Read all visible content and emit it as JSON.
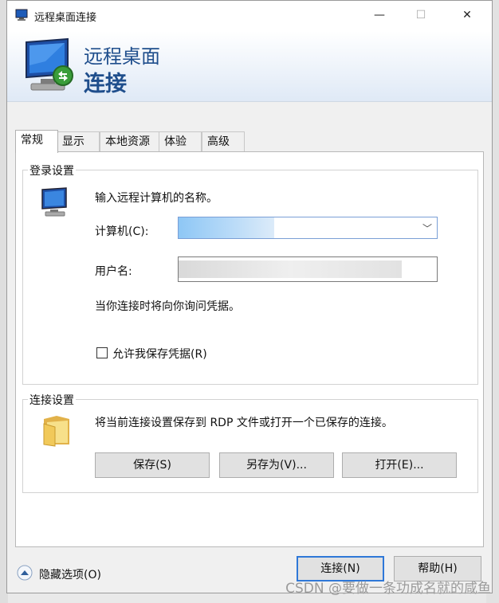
{
  "window": {
    "title": "远程桌面连接",
    "minimize_glyph": "—",
    "maximize_glyph": "☐",
    "close_glyph": "✕"
  },
  "banner": {
    "line1": "远程桌面",
    "line2": "连接",
    "icon": "monitor-remote-icon"
  },
  "tabs": [
    {
      "label": "常规",
      "active": true
    },
    {
      "label": "显示",
      "active": false
    },
    {
      "label": "本地资源",
      "active": false
    },
    {
      "label": "体验",
      "active": false
    },
    {
      "label": "高级",
      "active": false
    }
  ],
  "login_settings": {
    "legend": "登录设置",
    "instruction": "输入远程计算机的名称。",
    "computer_label": "计算机(C):",
    "username_label": "用户名:",
    "note": "当你连接时将向你询问凭据。",
    "allow_save_label": "允许我保存凭据(R)",
    "allow_save_checked": false
  },
  "connection_settings": {
    "legend": "连接设置",
    "description": "将当前连接设置保存到 RDP 文件或打开一个已保存的连接。",
    "save_label": "保存(S)",
    "save_as_label": "另存为(V)...",
    "open_label": "打开(E)..."
  },
  "footer": {
    "hide_options_label": "隐藏选项(O)",
    "connect_label": "连接(N)",
    "help_label": "帮助(H)"
  },
  "watermark": "CSDN @要做一条功成名就的咸鱼",
  "colors": {
    "accent": "#1f4e8c",
    "focus_border": "#2f78d8"
  }
}
